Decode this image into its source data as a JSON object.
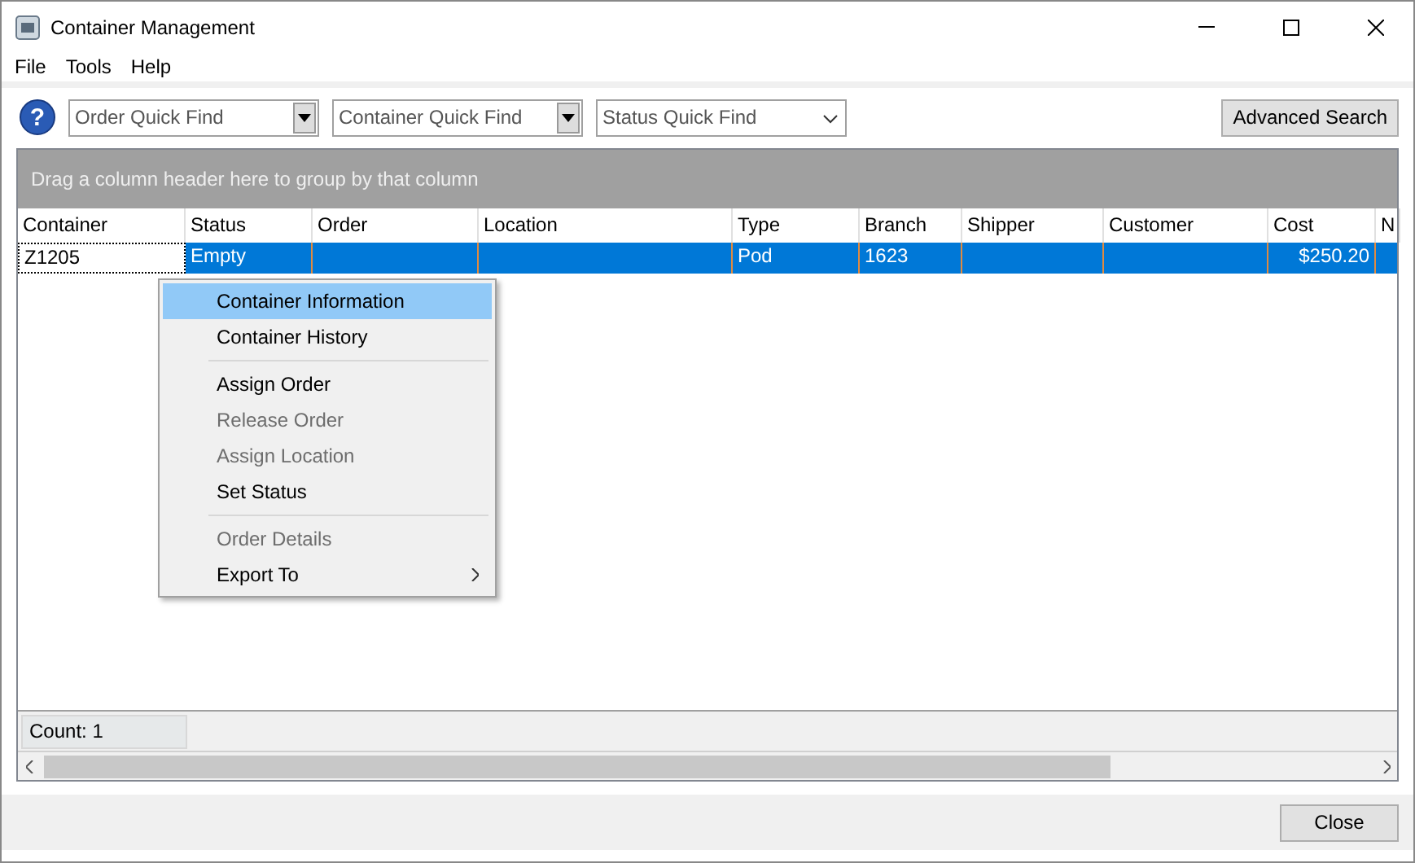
{
  "window": {
    "title": "Container Management"
  },
  "menu_bar": [
    "File",
    "Tools",
    "Help"
  ],
  "help_glyph": "?",
  "quick_finds": [
    {
      "placeholder": "Order Quick Find",
      "kind": "boxed"
    },
    {
      "placeholder": "Container Quick Find",
      "kind": "boxed"
    },
    {
      "placeholder": "Status Quick Find",
      "kind": "chevron"
    }
  ],
  "advanced_search": "Advanced Search",
  "group_panel": "Drag a column header here to group by that column",
  "table": {
    "columns": [
      "Container",
      "Status",
      "Order",
      "Location",
      "Type",
      "Branch",
      "Shipper",
      "Customer",
      "Cost",
      "N"
    ],
    "rows": [
      {
        "selected": true,
        "cells": [
          "Z1205",
          "Empty",
          "",
          "",
          "Pod",
          "1623",
          "",
          "",
          "$250.20",
          ""
        ]
      }
    ]
  },
  "context_menu": [
    {
      "label": "Container Information",
      "kind": "item",
      "disabled": false,
      "selected": true
    },
    {
      "label": "Container History",
      "kind": "item",
      "disabled": false,
      "selected": false
    },
    {
      "kind": "separator"
    },
    {
      "label": "Assign Order",
      "kind": "item",
      "disabled": false,
      "selected": false
    },
    {
      "label": "Release Order",
      "kind": "item",
      "disabled": true,
      "selected": false
    },
    {
      "label": "Assign Location",
      "kind": "item",
      "disabled": true,
      "selected": false
    },
    {
      "label": "Set Status",
      "kind": "item",
      "disabled": false,
      "selected": false
    },
    {
      "kind": "separator"
    },
    {
      "label": "Order Details",
      "kind": "item",
      "disabled": true,
      "selected": false
    },
    {
      "label": "Export To",
      "kind": "submenu",
      "disabled": false,
      "selected": false
    }
  ],
  "count": "Count: 1",
  "close_button": "Close"
}
